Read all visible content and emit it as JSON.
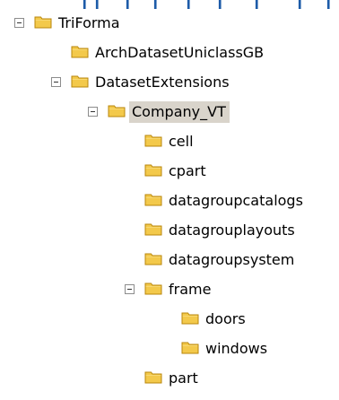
{
  "colors": {
    "folder_body": "#f3c94b",
    "folder_tab": "#f7d873",
    "folder_stroke": "#b8860b",
    "selection_bg": "#d9d4cb",
    "expander_border": "#8c8c8c",
    "strip_text": "#1d5ba8"
  },
  "icons": {
    "expander": "minus-expander-icon",
    "folder": "folder-icon"
  },
  "tree": {
    "nodes": [
      {
        "label": "TriForma",
        "expanded": true,
        "selected": false
      },
      {
        "label": "ArchDatasetUniclassGB",
        "expanded": false,
        "selected": false
      },
      {
        "label": "DatasetExtensions",
        "expanded": true,
        "selected": false
      },
      {
        "label": "Company_VT",
        "expanded": true,
        "selected": true
      },
      {
        "label": "cell",
        "expanded": false,
        "selected": false
      },
      {
        "label": "cpart",
        "expanded": false,
        "selected": false
      },
      {
        "label": "datagroupcatalogs",
        "expanded": false,
        "selected": false
      },
      {
        "label": "datagrouplayouts",
        "expanded": false,
        "selected": false
      },
      {
        "label": "datagroupsystem",
        "expanded": false,
        "selected": false
      },
      {
        "label": "frame",
        "expanded": true,
        "selected": false
      },
      {
        "label": "doors",
        "expanded": false,
        "selected": false
      },
      {
        "label": "windows",
        "expanded": false,
        "selected": false
      },
      {
        "label": "part",
        "expanded": false,
        "selected": false
      }
    ]
  }
}
